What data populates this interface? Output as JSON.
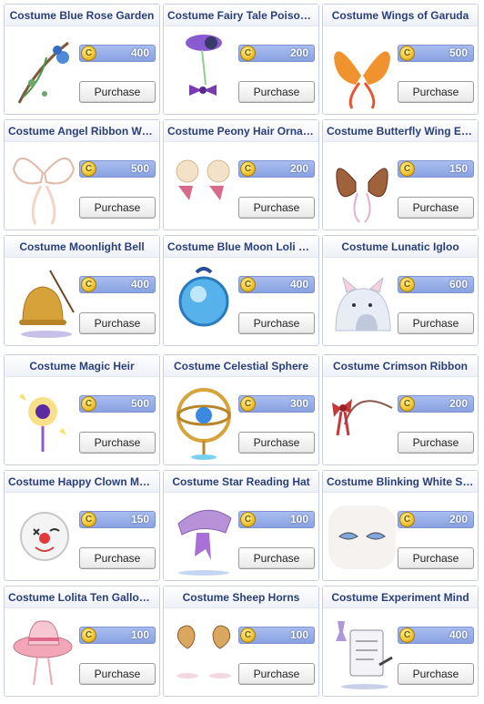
{
  "shop": {
    "items": [
      {
        "name": "Costume Blue Rose Garden",
        "price": "400",
        "button": "Purchase",
        "icon": "blue-rose-garden-icon",
        "color": "#4d8ad8"
      },
      {
        "name": "Costume Fairy Tale Poison ...",
        "price": "200",
        "button": "Purchase",
        "icon": "fairy-tale-poison-icon",
        "color": "#8a5ad0"
      },
      {
        "name": "Costume Wings of Garuda",
        "price": "500",
        "button": "Purchase",
        "icon": "garuda-wings-icon",
        "color": "#f0922e"
      },
      {
        "name": "Costume Angel Ribbon Wings",
        "price": "500",
        "button": "Purchase",
        "icon": "angel-ribbon-wings-icon",
        "color": "#f2d4c8"
      },
      {
        "name": "Costume Peony Hair Ornam...",
        "price": "200",
        "button": "Purchase",
        "icon": "peony-hair-ornament-icon",
        "color": "#f3e2c8"
      },
      {
        "name": "Costume Butterfly Wing Ears",
        "price": "150",
        "button": "Purchase",
        "icon": "butterfly-wing-ears-icon",
        "color": "#a0623a"
      },
      {
        "name": "Costume Moonlight Bell",
        "price": "400",
        "button": "Purchase",
        "icon": "moonlight-bell-icon",
        "color": "#d7a23a"
      },
      {
        "name": "Costume Blue Moon Loli Ruri",
        "price": "400",
        "button": "Purchase",
        "icon": "blue-moon-loli-ruri-icon",
        "color": "#57b2ec"
      },
      {
        "name": "Costume Lunatic Igloo",
        "price": "600",
        "button": "Purchase",
        "icon": "lunatic-igloo-icon",
        "color": "#e8ecf4"
      },
      {
        "name": "Costume Magic Heir",
        "price": "500",
        "button": "Purchase",
        "icon": "magic-heir-icon",
        "color": "#f4c93a"
      },
      {
        "name": "Costume Celestial Sphere",
        "price": "300",
        "button": "Purchase",
        "icon": "celestial-sphere-icon",
        "color": "#d6a43a"
      },
      {
        "name": "Costume Crimson Ribbon",
        "price": "200",
        "button": "Purchase",
        "icon": "crimson-ribbon-icon",
        "color": "#c43a3a"
      },
      {
        "name": "Costume Happy Clown Mask",
        "price": "150",
        "button": "Purchase",
        "icon": "happy-clown-mask-icon",
        "color": "#e23a3a"
      },
      {
        "name": "Costume Star Reading Hat",
        "price": "100",
        "button": "Purchase",
        "icon": "star-reading-hat-icon",
        "color": "#b792d8"
      },
      {
        "name": "Costume Blinking White Sa...",
        "price": "200",
        "button": "Purchase",
        "icon": "blinking-white-eyes-icon",
        "color": "#7ea8d8"
      },
      {
        "name": "Costume Lolita Ten Gallon H...",
        "price": "100",
        "button": "Purchase",
        "icon": "lolita-ten-gallon-hat-icon",
        "color": "#f2a6b6"
      },
      {
        "name": "Costume Sheep Horns",
        "price": "100",
        "button": "Purchase",
        "icon": "sheep-horns-icon",
        "color": "#d9a760"
      },
      {
        "name": "Costume Experiment Mind",
        "price": "400",
        "button": "Purchase",
        "icon": "experiment-mind-icon",
        "color": "#8f6cc8"
      }
    ]
  }
}
